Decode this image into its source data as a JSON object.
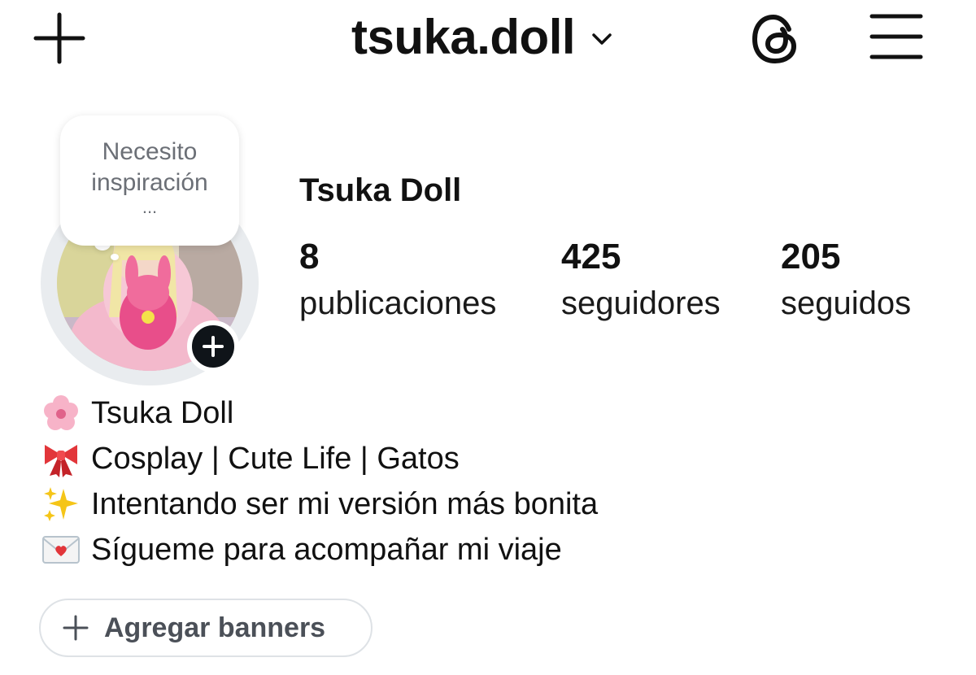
{
  "header": {
    "username": "tsuka.doll",
    "icons": [
      "plus-icon",
      "chevron-down-icon",
      "threads-icon",
      "menu-icon"
    ]
  },
  "note": {
    "text": "Necesito inspiración",
    "ellipsis": "..."
  },
  "profile": {
    "display_name": "Tsuka Doll",
    "stats": [
      {
        "value": "8",
        "label": "publicaciones"
      },
      {
        "value": "425",
        "label": "seguidores"
      },
      {
        "value": "205",
        "label": "seguidos"
      }
    ]
  },
  "bio": {
    "lines": [
      {
        "icon": "cherry-blossom-icon",
        "text": "Tsuka Doll"
      },
      {
        "icon": "ribbon-icon",
        "text": "Cosplay | Cute Life | Gatos"
      },
      {
        "icon": "sparkles-icon",
        "text": "Intentando ser mi versión más bonita"
      },
      {
        "icon": "love-letter-icon",
        "text": "Sígueme para acompañar mi viaje"
      }
    ]
  },
  "banner_button": {
    "label": "Agregar banners"
  },
  "colors": {
    "text": "#111111",
    "muted": "#6b6f76",
    "avatar_ring": "#e9ecef",
    "add_badge": "#0f1419",
    "button_border": "#dee2e6"
  }
}
